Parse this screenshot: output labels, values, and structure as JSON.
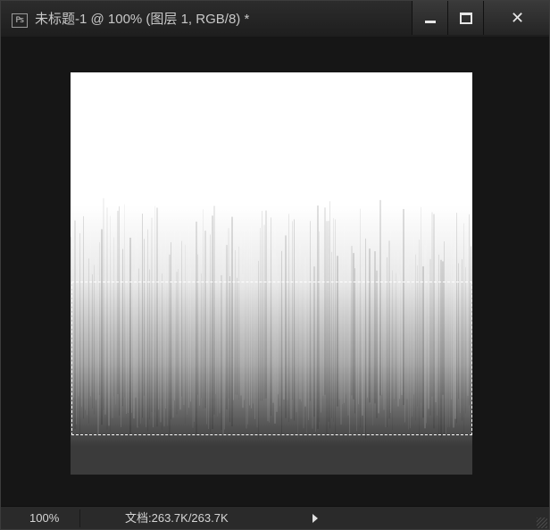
{
  "window": {
    "app_icon": "Ps",
    "title": "未标题-1 @ 100% (图层 1, RGB/8) *",
    "buttons": {
      "minimize": "minimize-icon",
      "maximize": "maximize-icon",
      "close": "close-icon"
    }
  },
  "canvas": {
    "background": "#ffffff",
    "gradient_bottom_color": "#3b3b3b",
    "has_selection_marquee": true
  },
  "status_bar": {
    "zoom": "100%",
    "doc_info": "文档:263.7K/263.7K",
    "menu_arrow": "play-arrow-icon"
  }
}
